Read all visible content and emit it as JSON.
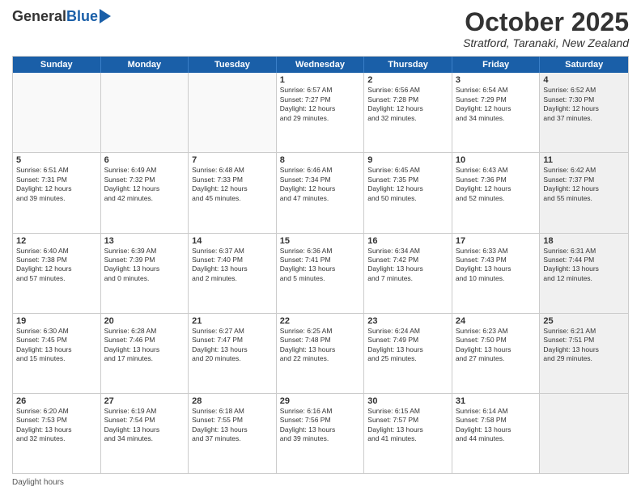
{
  "header": {
    "logo_general": "General",
    "logo_blue": "Blue",
    "month_title": "October 2025",
    "location": "Stratford, Taranaki, New Zealand"
  },
  "days_of_week": [
    "Sunday",
    "Monday",
    "Tuesday",
    "Wednesday",
    "Thursday",
    "Friday",
    "Saturday"
  ],
  "weeks": [
    [
      {
        "day": "",
        "text": "",
        "empty": true
      },
      {
        "day": "",
        "text": "",
        "empty": true
      },
      {
        "day": "",
        "text": "",
        "empty": true
      },
      {
        "day": "1",
        "text": "Sunrise: 6:57 AM\nSunset: 7:27 PM\nDaylight: 12 hours\nand 29 minutes.",
        "empty": false
      },
      {
        "day": "2",
        "text": "Sunrise: 6:56 AM\nSunset: 7:28 PM\nDaylight: 12 hours\nand 32 minutes.",
        "empty": false
      },
      {
        "day": "3",
        "text": "Sunrise: 6:54 AM\nSunset: 7:29 PM\nDaylight: 12 hours\nand 34 minutes.",
        "empty": false
      },
      {
        "day": "4",
        "text": "Sunrise: 6:52 AM\nSunset: 7:30 PM\nDaylight: 12 hours\nand 37 minutes.",
        "empty": false,
        "shaded": true
      }
    ],
    [
      {
        "day": "5",
        "text": "Sunrise: 6:51 AM\nSunset: 7:31 PM\nDaylight: 12 hours\nand 39 minutes.",
        "empty": false
      },
      {
        "day": "6",
        "text": "Sunrise: 6:49 AM\nSunset: 7:32 PM\nDaylight: 12 hours\nand 42 minutes.",
        "empty": false
      },
      {
        "day": "7",
        "text": "Sunrise: 6:48 AM\nSunset: 7:33 PM\nDaylight: 12 hours\nand 45 minutes.",
        "empty": false
      },
      {
        "day": "8",
        "text": "Sunrise: 6:46 AM\nSunset: 7:34 PM\nDaylight: 12 hours\nand 47 minutes.",
        "empty": false
      },
      {
        "day": "9",
        "text": "Sunrise: 6:45 AM\nSunset: 7:35 PM\nDaylight: 12 hours\nand 50 minutes.",
        "empty": false
      },
      {
        "day": "10",
        "text": "Sunrise: 6:43 AM\nSunset: 7:36 PM\nDaylight: 12 hours\nand 52 minutes.",
        "empty": false
      },
      {
        "day": "11",
        "text": "Sunrise: 6:42 AM\nSunset: 7:37 PM\nDaylight: 12 hours\nand 55 minutes.",
        "empty": false,
        "shaded": true
      }
    ],
    [
      {
        "day": "12",
        "text": "Sunrise: 6:40 AM\nSunset: 7:38 PM\nDaylight: 12 hours\nand 57 minutes.",
        "empty": false
      },
      {
        "day": "13",
        "text": "Sunrise: 6:39 AM\nSunset: 7:39 PM\nDaylight: 13 hours\nand 0 minutes.",
        "empty": false
      },
      {
        "day": "14",
        "text": "Sunrise: 6:37 AM\nSunset: 7:40 PM\nDaylight: 13 hours\nand 2 minutes.",
        "empty": false
      },
      {
        "day": "15",
        "text": "Sunrise: 6:36 AM\nSunset: 7:41 PM\nDaylight: 13 hours\nand 5 minutes.",
        "empty": false
      },
      {
        "day": "16",
        "text": "Sunrise: 6:34 AM\nSunset: 7:42 PM\nDaylight: 13 hours\nand 7 minutes.",
        "empty": false
      },
      {
        "day": "17",
        "text": "Sunrise: 6:33 AM\nSunset: 7:43 PM\nDaylight: 13 hours\nand 10 minutes.",
        "empty": false
      },
      {
        "day": "18",
        "text": "Sunrise: 6:31 AM\nSunset: 7:44 PM\nDaylight: 13 hours\nand 12 minutes.",
        "empty": false,
        "shaded": true
      }
    ],
    [
      {
        "day": "19",
        "text": "Sunrise: 6:30 AM\nSunset: 7:45 PM\nDaylight: 13 hours\nand 15 minutes.",
        "empty": false
      },
      {
        "day": "20",
        "text": "Sunrise: 6:28 AM\nSunset: 7:46 PM\nDaylight: 13 hours\nand 17 minutes.",
        "empty": false
      },
      {
        "day": "21",
        "text": "Sunrise: 6:27 AM\nSunset: 7:47 PM\nDaylight: 13 hours\nand 20 minutes.",
        "empty": false
      },
      {
        "day": "22",
        "text": "Sunrise: 6:25 AM\nSunset: 7:48 PM\nDaylight: 13 hours\nand 22 minutes.",
        "empty": false
      },
      {
        "day": "23",
        "text": "Sunrise: 6:24 AM\nSunset: 7:49 PM\nDaylight: 13 hours\nand 25 minutes.",
        "empty": false
      },
      {
        "day": "24",
        "text": "Sunrise: 6:23 AM\nSunset: 7:50 PM\nDaylight: 13 hours\nand 27 minutes.",
        "empty": false
      },
      {
        "day": "25",
        "text": "Sunrise: 6:21 AM\nSunset: 7:51 PM\nDaylight: 13 hours\nand 29 minutes.",
        "empty": false,
        "shaded": true
      }
    ],
    [
      {
        "day": "26",
        "text": "Sunrise: 6:20 AM\nSunset: 7:53 PM\nDaylight: 13 hours\nand 32 minutes.",
        "empty": false
      },
      {
        "day": "27",
        "text": "Sunrise: 6:19 AM\nSunset: 7:54 PM\nDaylight: 13 hours\nand 34 minutes.",
        "empty": false
      },
      {
        "day": "28",
        "text": "Sunrise: 6:18 AM\nSunset: 7:55 PM\nDaylight: 13 hours\nand 37 minutes.",
        "empty": false
      },
      {
        "day": "29",
        "text": "Sunrise: 6:16 AM\nSunset: 7:56 PM\nDaylight: 13 hours\nand 39 minutes.",
        "empty": false
      },
      {
        "day": "30",
        "text": "Sunrise: 6:15 AM\nSunset: 7:57 PM\nDaylight: 13 hours\nand 41 minutes.",
        "empty": false
      },
      {
        "day": "31",
        "text": "Sunrise: 6:14 AM\nSunset: 7:58 PM\nDaylight: 13 hours\nand 44 minutes.",
        "empty": false
      },
      {
        "day": "",
        "text": "",
        "empty": true,
        "shaded": true
      }
    ]
  ],
  "footer": {
    "daylight_label": "Daylight hours"
  }
}
